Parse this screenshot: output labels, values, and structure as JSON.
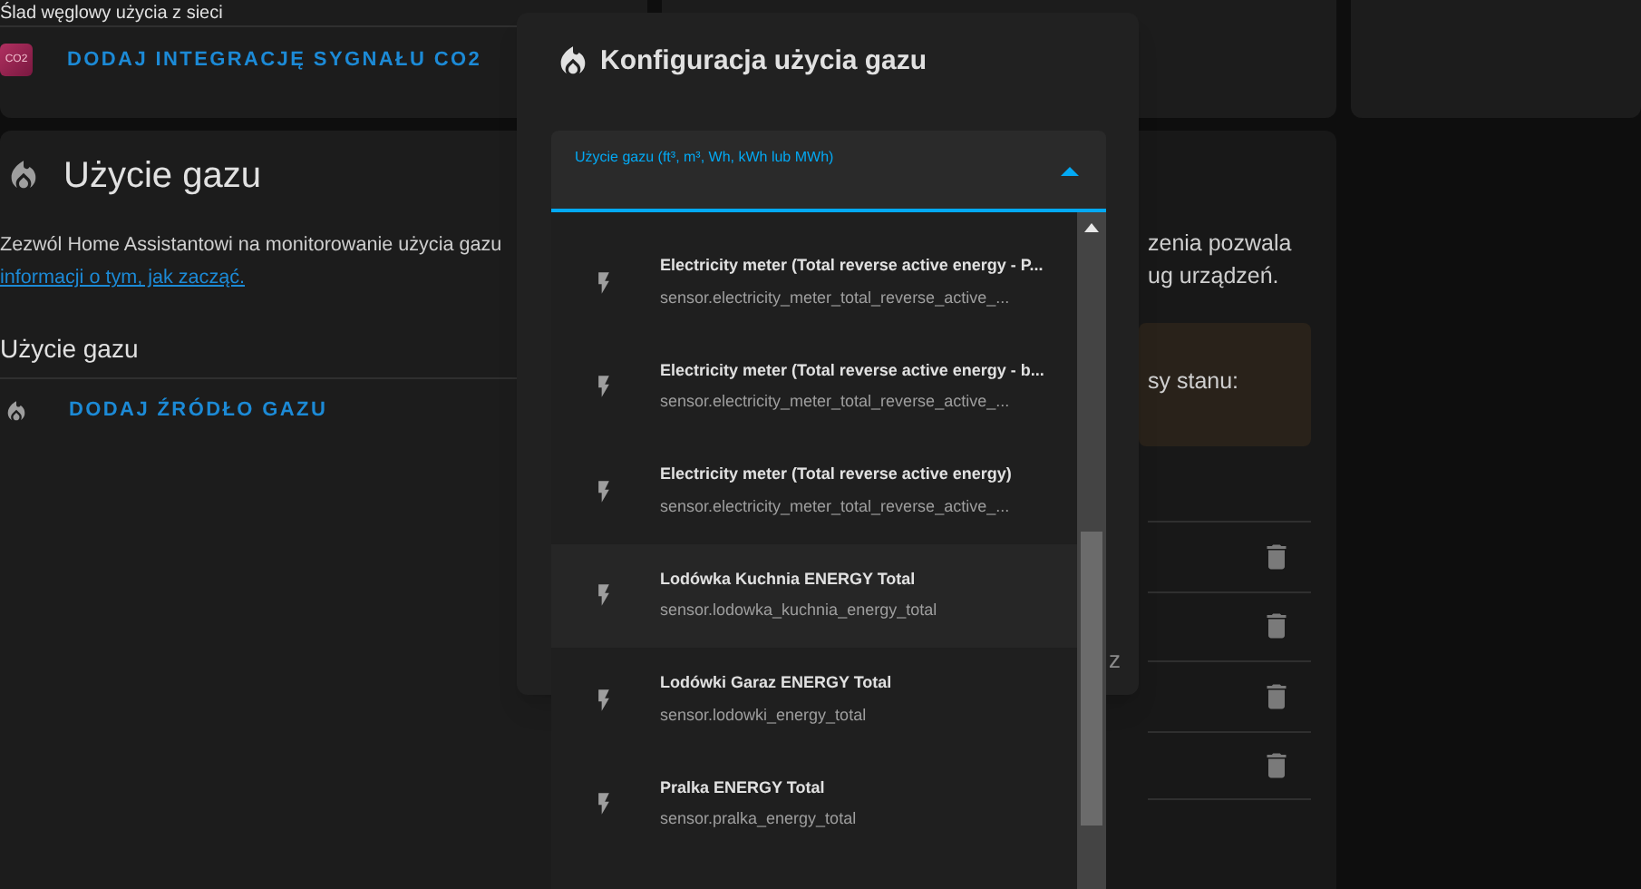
{
  "grid_card": {
    "title": "Ślad węglowy użycia z sieci",
    "logo_text": "CO2",
    "action": "DODAJ INTEGRACJĘ SYGNAŁU CO2"
  },
  "gas_card": {
    "title": "Użycie gazu",
    "description": "Zezwól Home Assistantowi na monitorowanie użycia gazu",
    "link": "informacji o tym, jak zacząć.",
    "section": "Użycie gazu",
    "action": "DODAJ ŹRÓDŁO GAZU"
  },
  "right_card": {
    "text_lines": [
      "zenia pozwala",
      "ug urządzeń."
    ],
    "warning": "sy stanu:"
  },
  "dialog": {
    "title": "Konfiguracja użycia gazu",
    "field": {
      "label": "Użycie gazu (ft³, m³, Wh, kWh lub MWh)",
      "expanded": true
    },
    "button_partial": "z"
  },
  "dropdown": {
    "items": [
      {
        "name": "Electricity meter (Total reverse active energy - P...",
        "entity": "sensor.electricity_meter_total_reverse_active_...",
        "selected": false
      },
      {
        "name": "Electricity meter (Total reverse active energy - b...",
        "entity": "sensor.electricity_meter_total_reverse_active_...",
        "selected": false
      },
      {
        "name": "Electricity meter (Total reverse active energy)",
        "entity": "sensor.electricity_meter_total_reverse_active_...",
        "selected": false
      },
      {
        "name": "Lodówka Kuchnia ENERGY Total",
        "entity": "sensor.lodowka_kuchnia_energy_total",
        "selected": true
      },
      {
        "name": "Lodówki Garaz ENERGY Total",
        "entity": "sensor.lodowki_energy_total",
        "selected": false
      },
      {
        "name": "Pralka ENERGY Total",
        "entity": "sensor.pralka_energy_total",
        "selected": false
      }
    ]
  }
}
